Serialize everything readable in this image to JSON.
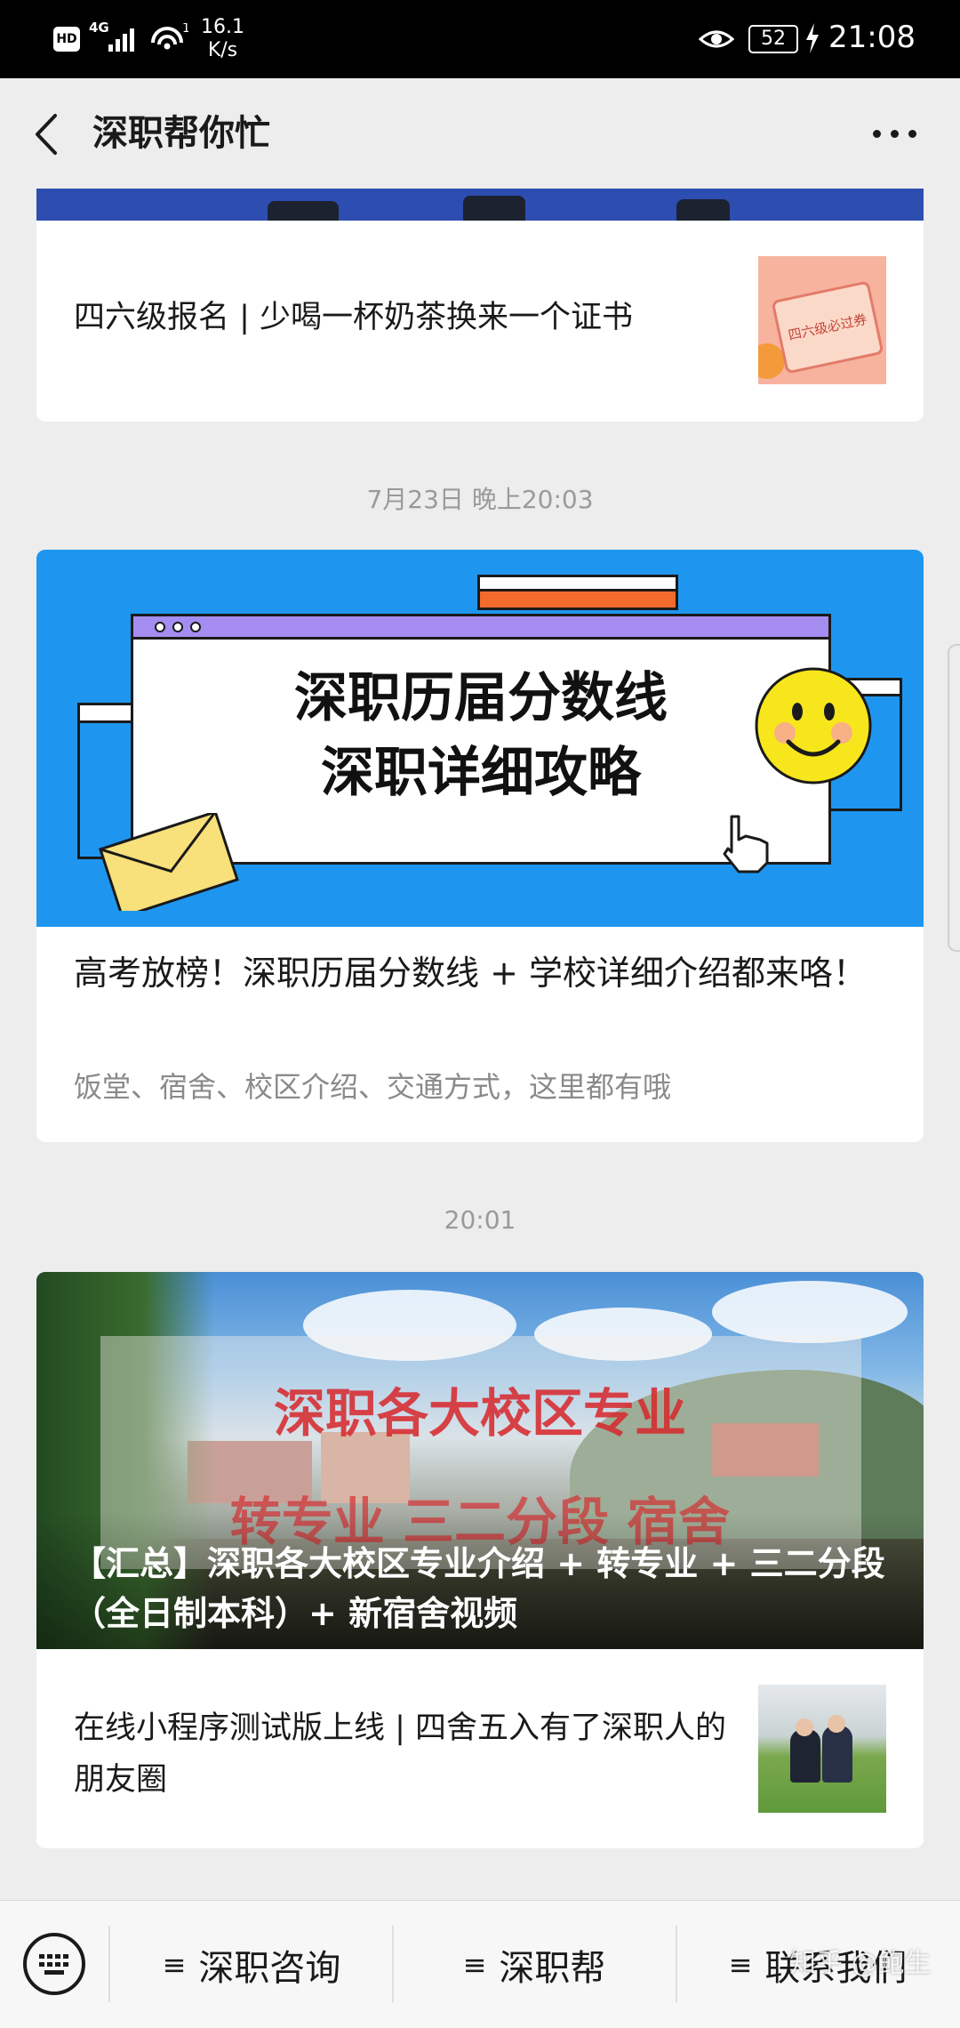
{
  "status_bar": {
    "hd": "HD",
    "network": "4G",
    "hotspot_count": "1",
    "speed_value": "16.1",
    "speed_unit": "K/s",
    "battery": "52",
    "time": "21:08"
  },
  "nav": {
    "title": "深职帮你忙",
    "back_icon": "chevron-left-icon",
    "more_icon": "more-dots-icon"
  },
  "articles": [
    {
      "title": "四六级报名 | 少喝一杯奶茶换来一个证书",
      "thumb_text": "四六级必过券"
    },
    {
      "time": "7月23日 晚上20:03",
      "banner_line1": "深职历届分数线",
      "banner_line2": "深职详细攻略",
      "title": "高考放榜！深职历届分数线 + 学校详细介绍都来咯！",
      "subtitle": "饭堂、宿舍、校区介绍、交通方式，这里都有哦"
    },
    {
      "time": "20:01",
      "banner_red_line1": "深职各大校区专业",
      "banner_red_line2": "转专业 三二分段 宿舍",
      "banner_title": "【汇总】深职各大校区专业介绍 + 转专业 + 三二分段（全日制本科）+ 新宿舍视频",
      "sub_title": "在线小程序测试版上线 | 四舍五入有了深职人的朋友圈"
    }
  ],
  "bottom_menu": {
    "keyboard_icon": "keyboard-icon",
    "menu_icon_glyph": "≡",
    "items": [
      {
        "label": "深职咨询"
      },
      {
        "label": "深职帮"
      },
      {
        "label": "联系我们"
      }
    ]
  },
  "watermark": "知乎 @鲍生"
}
